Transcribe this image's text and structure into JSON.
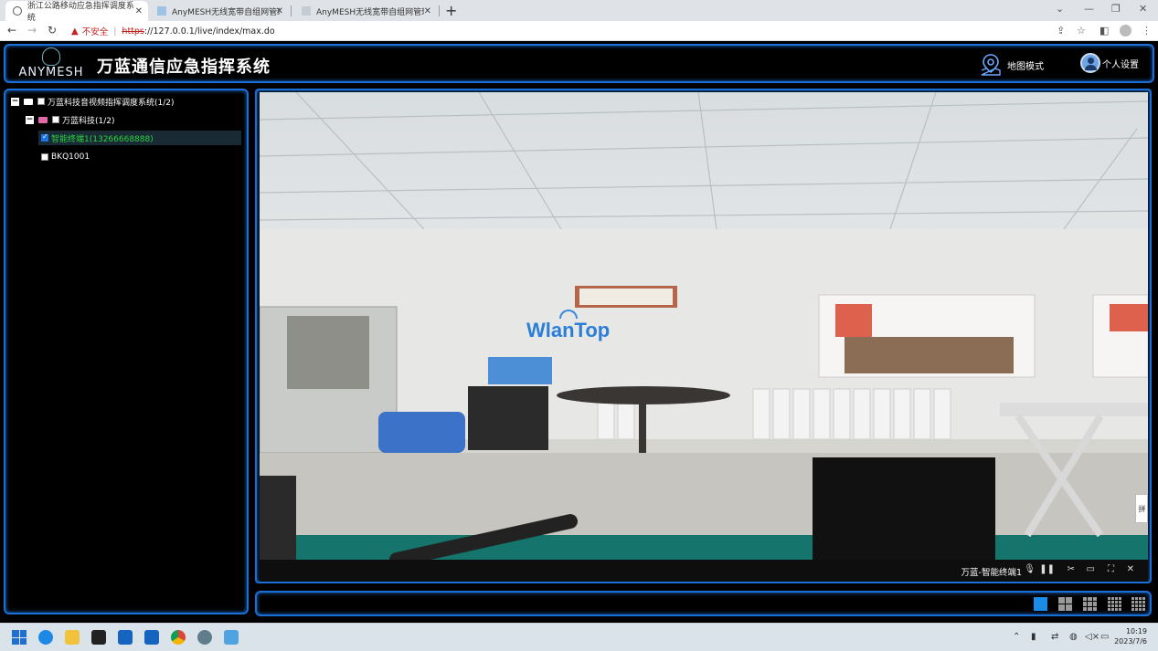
{
  "browser": {
    "tabs": [
      {
        "title": "浙江公路移动应急指挥调度系统"
      },
      {
        "title": "AnyMESH无线宽带自组网管理系"
      },
      {
        "title": "AnyMESH无线宽带自组网管理系"
      }
    ],
    "address": {
      "warning_label": "不安全",
      "scheme": "https",
      "rest": "://127.0.0.1/live/index/max.do"
    }
  },
  "app": {
    "logo_text": "ANYMESH",
    "title": "万蓝通信应急指挥系统",
    "map_mode_label": "地图模式",
    "personal_settings_label": "个人设置"
  },
  "tree": {
    "root": {
      "label": "万蓝科技音视频指挥调度系统(1/2)"
    },
    "group": {
      "label": "万蓝科技(1/2)"
    },
    "devices": [
      {
        "label": "智能终端1(13266668888)",
        "checked": true,
        "selected": true,
        "color": "#28d33c"
      },
      {
        "label": "BKQ1001",
        "checked": false,
        "selected": false
      }
    ]
  },
  "video": {
    "watermark": "WlanTop",
    "stream_label": "万蓝-智能终端1"
  },
  "side_handle": "拼",
  "taskbar": {
    "time": "10:19",
    "date": "2023/7/6"
  },
  "colors": {
    "accent_border": "#1b6fd6",
    "selected_text": "#28d33c",
    "active_layout": "#1a8be6"
  }
}
